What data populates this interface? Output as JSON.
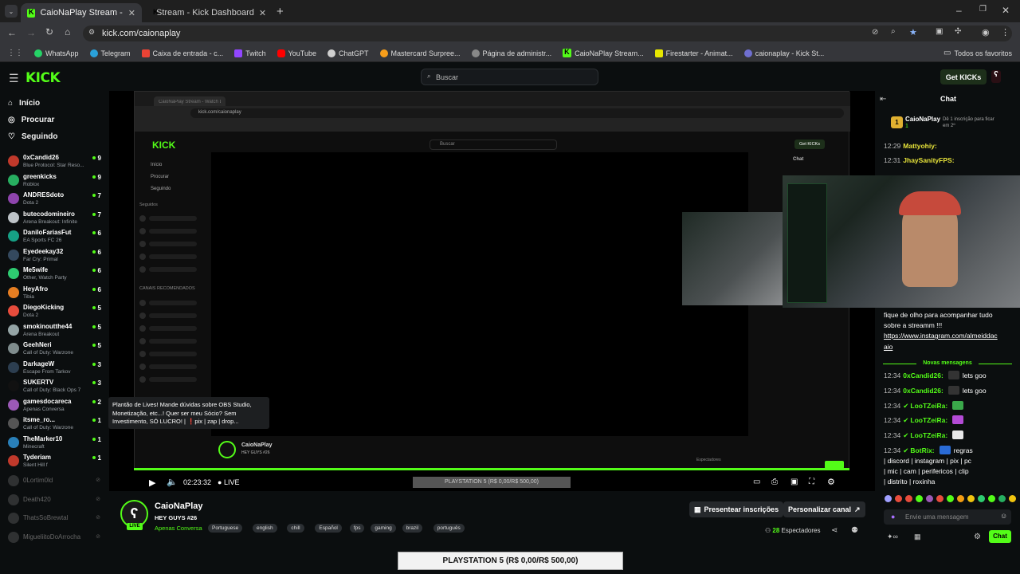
{
  "browser": {
    "tabs": [
      {
        "label": "CaioNaPlay Stream - Watch Live",
        "active": true
      },
      {
        "label": "Stream - Kick Dashboard",
        "active": false
      }
    ],
    "url": "kick.com/caionaplay",
    "bookmarks": [
      "WhatsApp",
      "Telegram",
      "Caixa de entrada - c...",
      "Twitch",
      "YouTube",
      "ChatGPT",
      "Mastercard Surpree...",
      "Página de administr...",
      "CaioNaPlay Stream...",
      "Firestarter - Animat...",
      "caionaplay - Kick St..."
    ],
    "all_bookmarks": "Todos os favoritos"
  },
  "kick": {
    "logo": "KICK",
    "search_placeholder": "Buscar",
    "get_kicks": "Get KICKs"
  },
  "sidebar": {
    "nav": [
      "Início",
      "Procurar",
      "Seguindo"
    ],
    "channels": [
      {
        "name": "0xCandid26",
        "category": "Blue Protocol: Star Reso...",
        "viewers": "9",
        "color": "#c0392b"
      },
      {
        "name": "greenkicks",
        "category": "Roblox",
        "viewers": "9",
        "color": "#27ae60"
      },
      {
        "name": "ANDRESdoto",
        "category": "Dota 2",
        "viewers": "7",
        "color": "#8e44ad"
      },
      {
        "name": "butecodomineiro",
        "category": "Arena Breakout: Infinite",
        "viewers": "7",
        "color": "#bdc3c7"
      },
      {
        "name": "DaniloFariasFut",
        "category": "EA Sports FC 26",
        "viewers": "6",
        "color": "#16a085"
      },
      {
        "name": "Eyedeekay32",
        "category": "Far Cry: Primal",
        "viewers": "6",
        "color": "#34495e"
      },
      {
        "name": "Me5wife",
        "category": "Other, Watch Party",
        "viewers": "6",
        "color": "#2ecc71"
      },
      {
        "name": "HeyAfro",
        "category": "Tibia",
        "viewers": "6",
        "color": "#e67e22"
      },
      {
        "name": "DiegoKicking",
        "category": "Dota 2",
        "viewers": "5",
        "color": "#e74c3c"
      },
      {
        "name": "smokinoutthe44",
        "category": "Arena Breakout",
        "viewers": "5",
        "color": "#95a5a6"
      },
      {
        "name": "GeehNeri",
        "category": "Call of Duty: Warzone",
        "viewers": "5",
        "color": "#7f8c8d"
      },
      {
        "name": "DarkageW",
        "category": "Escape From Tarkov",
        "viewers": "3",
        "color": "#2c3e50"
      },
      {
        "name": "SUKERTV",
        "category": "Call of Duty: Black Ops 7",
        "viewers": "3",
        "color": "#111111"
      },
      {
        "name": "gamesdocareca",
        "category": "Apenas Conversa",
        "viewers": "2",
        "color": "#9b59b6"
      },
      {
        "name": "itsme_ro...",
        "category": "Call of Duty: Warzone",
        "viewers": "1",
        "color": "#555555"
      },
      {
        "name": "TheMarker10",
        "category": "Minecraft",
        "viewers": "1",
        "color": "#2980b9"
      },
      {
        "name": "Tyderiam",
        "category": "Silent Hill f",
        "viewers": "1",
        "color": "#c0392b"
      }
    ],
    "offline": [
      "0Lortim0ld",
      "Death420",
      "ThatsSoBrewtal",
      "MigueliitoDoArrocha"
    ]
  },
  "tooltip": {
    "line1": "Plantão de Lives! Mande dúvidas sobre OBS Studio,",
    "line2": "Monetização, etc...! Quer ser meu Sócio? Sem",
    "line3": "Investimento, SÓ LUCRO! | ❗pix | zap | drop..."
  },
  "inner": {
    "tab": "CaioNaPlay Stream - Watch Li...",
    "url": "kick.com/caionaplay",
    "nav": [
      "Início",
      "Procurar",
      "Seguindo"
    ],
    "section1": "Seguidos",
    "section2": "CANAIS RECOMENDADOS",
    "chat": "Chat",
    "get_kicks": "Get KICKs",
    "search": "Buscar",
    "streamer": "CaioNaPlay",
    "title": "HEY GUYS #26",
    "viewers": "Espectadores"
  },
  "player": {
    "time": "02:23:32",
    "live": "LIVE",
    "goal": "PLAYSTATION 5 (R$ 0,00/R$ 500,00)"
  },
  "stream": {
    "streamer": "CaioNaPlay",
    "title": "HEY GUYS #26",
    "category": "Apenas Conversa",
    "tags": [
      "Portuguese",
      "english",
      "chill",
      "Español",
      "fps",
      "gaming",
      "brazil",
      "português"
    ],
    "btn_subs": "Presentear inscrições",
    "btn_custom": "Personalizar canal",
    "viewers": "28",
    "viewers_label": "Espectadores",
    "live_badge": "LIVE"
  },
  "chat": {
    "header": "Chat",
    "top_user": "CaioNaPlay",
    "top_user_count": "1",
    "sub_gift": "Dê 1 inscrição para ficar em 2º",
    "messages_top": [
      {
        "time": "12:29",
        "user": "Mattyohiy:"
      },
      {
        "time": "12:31",
        "user": "JhaySanityFPS:"
      }
    ],
    "pinned_text": [
      "fique de olho para acompanhar tudo",
      "sobre a streamm !!!"
    ],
    "pinned_link": [
      "https://www.instagram.com/almeiddac",
      "aio"
    ],
    "new_messages": "Novas mensagens",
    "messages": [
      {
        "time": "12:34",
        "user": "0xCandid26:",
        "text": "lets goo"
      },
      {
        "time": "12:34",
        "user": "0xCandid26:",
        "text": "lets goo"
      },
      {
        "time": "12:34",
        "user": "LooTZeiRa:",
        "text": ""
      },
      {
        "time": "12:34",
        "user": "LooTZeiRa:",
        "text": ""
      },
      {
        "time": "12:34",
        "user": "LooTZeiRa:",
        "text": ""
      },
      {
        "time": "12:34",
        "user": "BotRix:",
        "text": "regras"
      }
    ],
    "botrix_lines": [
      "| discord | instagram | pix | pc",
      "| mic | cam | perifericos | clip",
      "| distrito | roxinha"
    ],
    "input_placeholder": "Envie uma mensagem",
    "chat_btn": "Chat"
  }
}
